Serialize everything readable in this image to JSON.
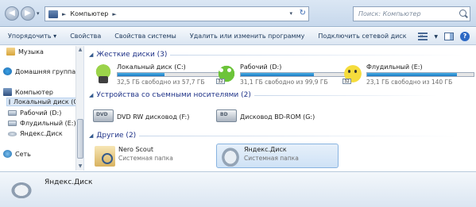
{
  "address": {
    "crumb": "Компьютер"
  },
  "search": {
    "placeholder": "Поиск: Компьютер"
  },
  "toolbar": {
    "organize": "Упорядочить ▾",
    "properties": "Свойства",
    "system_properties": "Свойства системы",
    "uninstall": "Удалить или изменить программу",
    "map_drive": "Подключить сетевой диск",
    "more": "»"
  },
  "nav": {
    "music": "Музыка",
    "homegroup": "Домашняя группа",
    "computer": "Компьютер",
    "drive_c": "Локальный диск (C",
    "drive_d": "Рабочий (D:)",
    "drive_e": "Флудильный (E:)",
    "yandex": "Яндекс.Диск",
    "network": "Сеть"
  },
  "groups": {
    "hdd": "Жесткие диски (3)",
    "removable": "Устройства со съемными носителями (2)",
    "other": "Другие (2)"
  },
  "drives": [
    {
      "name": "Локальный диск (C:)",
      "free": "32,5 ГБ свободно из 57,7 ГБ",
      "used_fraction": 0.44
    },
    {
      "name": "Рабочий (D:)",
      "free": "31,1 ГБ свободно из 99,9 ГБ",
      "used_fraction": 0.69
    },
    {
      "name": "Флудильный (E:)",
      "free": "23,1 ГБ свободно из 140 ГБ",
      "used_fraction": 0.84
    }
  ],
  "removable": [
    {
      "name": "DVD RW дисковод (F:)"
    },
    {
      "name": "Дисковод BD-ROM (G:)"
    }
  ],
  "other": [
    {
      "name": "Nero Scout",
      "sub": "Системная папка"
    },
    {
      "name": "Яндекс.Диск",
      "sub": "Системная папка"
    }
  ],
  "details": {
    "name": "Яндекс.Диск"
  }
}
